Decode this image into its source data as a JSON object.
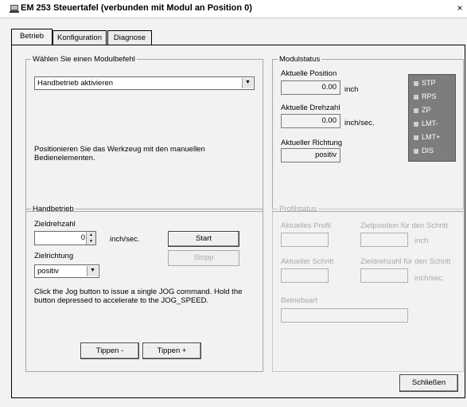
{
  "window": {
    "title": "EM 253 Steuertafel (verbunden mit Modul an Position 0)",
    "close_glyph": "×"
  },
  "tabs": [
    {
      "label": "Betrieb",
      "active": true
    },
    {
      "label": "Konfiguration",
      "active": false
    },
    {
      "label": "Diagnose",
      "active": false
    }
  ],
  "modulbefehl": {
    "legend": "Wählen Sie einen Modulbefehl",
    "selected": "Handbetrieb aktivieren",
    "description": "Positionieren Sie das Werkzeug mit den manuellen Bedienelementen."
  },
  "modulstatus": {
    "legend": "Modulstatus",
    "position_label": "Aktuelle Position",
    "position_value": "0.00",
    "position_unit": "inch",
    "speed_label": "Aktuelle Drehzahl",
    "speed_value": "0.00",
    "speed_unit": "inch/sec.",
    "direction_label": "Aktueller Richtung",
    "direction_value": "positiv",
    "flags": [
      "STP",
      "RPS",
      "ZP",
      "LMT-",
      "LMT+",
      "DIS"
    ]
  },
  "handbetrieb": {
    "legend": "Handbetrieb",
    "speed_label": "Zieldrehzahl",
    "speed_value": "0",
    "speed_unit": "inch/sec.",
    "start_label": "Start",
    "stop_label": "Stopp",
    "direction_label": "Zielrichtung",
    "direction_value": "positiv",
    "hint": "Click the Jog button to issue a single JOG command. Hold the button depressed to accelerate to the JOG_SPEED.",
    "jog_minus": "Tippen -",
    "jog_plus": "Tippen +"
  },
  "profilstatus": {
    "legend": "Profilstatus",
    "profile_label": "Aktuelles Profil",
    "target_pos_label": "Zielposition für den Schritt",
    "target_pos_unit": "inch",
    "step_label": "Aktueller Schritt",
    "target_speed_label": "Zieldrehzahl für den Schritt",
    "target_speed_unit": "inch/sec.",
    "mode_label": "Betriebsart"
  },
  "footer": {
    "close_label": "Schließen"
  }
}
